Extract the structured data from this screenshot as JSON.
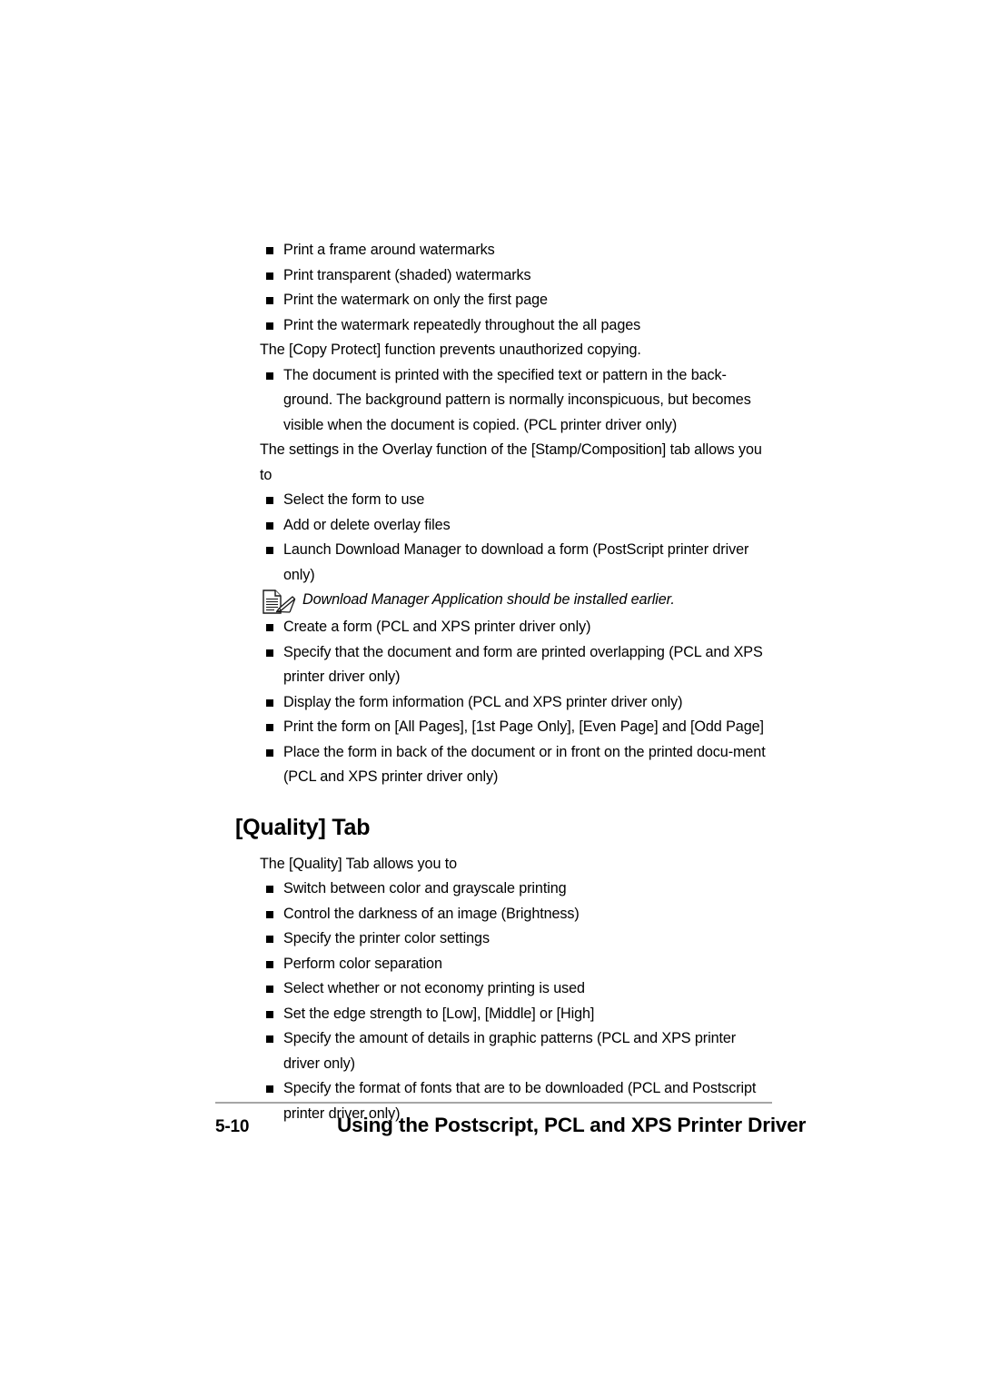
{
  "document": {
    "blocks": [
      {
        "type": "bullet",
        "text": "Print a frame around watermarks"
      },
      {
        "type": "bullet",
        "text": "Print transparent (shaded) watermarks"
      },
      {
        "type": "bullet",
        "text": "Print the watermark on only the first page"
      },
      {
        "type": "bullet",
        "text": "Print the watermark repeatedly throughout the all pages"
      },
      {
        "type": "para",
        "text": "The [Copy Protect] function prevents unauthorized copying."
      },
      {
        "type": "bullet",
        "text": "The document is printed with the specified text or pattern in the back-ground. The background pattern is normally inconspicuous, but becomes visible when the document is copied. (PCL printer driver only)"
      },
      {
        "type": "para",
        "text": "The settings in the Overlay function of the [Stamp/Composition] tab allows you to"
      },
      {
        "type": "bullet",
        "text": "Select the form to use"
      },
      {
        "type": "bullet",
        "text": "Add or delete overlay files"
      },
      {
        "type": "bullet",
        "text": "Launch Download Manager to download a form (PostScript printer driver only)"
      },
      {
        "type": "note",
        "icon": "note-memo-icon",
        "text": "Download Manager Application should be installed earlier."
      },
      {
        "type": "bullet",
        "text": "Create a form (PCL and XPS printer driver only)"
      },
      {
        "type": "bullet",
        "text": "Specify that the document and form are printed overlapping (PCL and XPS printer driver only)"
      },
      {
        "type": "bullet",
        "text": "Display the form information (PCL and XPS printer driver only)"
      },
      {
        "type": "bullet",
        "text": "Print the form on [All Pages], [1st Page Only], [Even Page] and [Odd Page]"
      },
      {
        "type": "bullet",
        "text": "Place the form in back of the document or in front on the printed docu-ment (PCL and XPS printer driver only)"
      },
      {
        "type": "heading",
        "text": "[Quality] Tab"
      },
      {
        "type": "para",
        "text": "The [Quality] Tab allows you to"
      },
      {
        "type": "bullet",
        "text": "Switch between color and grayscale printing"
      },
      {
        "type": "bullet",
        "text": "Control the darkness of an image (Brightness)"
      },
      {
        "type": "bullet",
        "text": "Specify the printer color settings"
      },
      {
        "type": "bullet",
        "text": "Perform color separation"
      },
      {
        "type": "bullet",
        "text": "Select whether or not economy printing is used"
      },
      {
        "type": "bullet",
        "text": "Set the edge strength to [Low], [Middle] or [High]"
      },
      {
        "type": "bullet",
        "text": "Specify the amount of details in graphic patterns (PCL and XPS printer driver only)"
      },
      {
        "type": "bullet",
        "text": "Specify the format of fonts that are to be downloaded (PCL and Postscript printer driver only)"
      }
    ]
  },
  "footer": {
    "page_number": "5-10",
    "chapter_title": "Using the Postscript, PCL and XPS Printer Driver",
    "rule_color": "#a6a6a6"
  },
  "colors": {
    "text": "#000000",
    "background": "#ffffff",
    "bullet_marker": "#000000"
  }
}
